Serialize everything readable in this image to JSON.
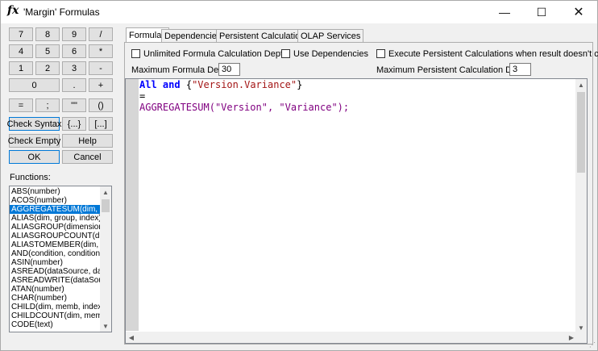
{
  "window": {
    "title": "'Margin' Formulas",
    "icon": "fx",
    "minimize": "—",
    "maximize": "☐",
    "close": "✕"
  },
  "keypad": [
    "7",
    "8",
    "9",
    "/",
    "4",
    "5",
    "6",
    "*",
    "1",
    "2",
    "3",
    "-",
    "0",
    ".",
    "+",
    "=",
    ";",
    "\"\"",
    "()"
  ],
  "buttons": {
    "check_syntax": "Check Syntax",
    "braces": "{...}",
    "brackets": "[...]",
    "check_empty": "Check Empty",
    "help": "Help",
    "ok": "OK",
    "cancel": "Cancel"
  },
  "functions": {
    "label": "Functions:",
    "items": [
      "ABS(number)",
      "ACOS(number)",
      "AGGREGATESUM(dim, memb",
      "ALIAS(dim, group, index)",
      "ALIASGROUP(dimension, ir",
      "ALIASGROUPCOUNT(dime",
      "ALIASTOMEMBER(dim, gro",
      "AND(condition, condition, ...",
      "ASIN(number)",
      "ASREAD(dataSource, data",
      "ASREADWRITE(dataSourc",
      "ATAN(number)",
      "CHAR(number)",
      "CHILD(dim, memb, index)",
      "CHILDCOUNT(dim, memb)",
      "CODE(text)"
    ],
    "selected_index": 2
  },
  "tabs": [
    "Formulas",
    "Dependencies",
    "Persistent Calculations",
    "OLAP Services"
  ],
  "options": {
    "unlimited_depth": "Unlimited Formula Calculation Depth",
    "use_dependencies": "Use Dependencies",
    "execute_persistent": "Execute Persistent Calculations when result doesn't change",
    "max_formula_depth_label": "Maximum Formula Depth:",
    "max_formula_depth_value": "30",
    "max_persistent_depth_label": "Maximum Persistent Calculation Depth:",
    "max_persistent_depth_value": "3"
  },
  "code": {
    "line1_kw1": "All",
    "line1_kw2": "and",
    "line1_open": "{",
    "line1_str": "\"Version.Variance\"",
    "line1_close": "}",
    "line2": "=",
    "line3_fn": "AGGREGATESUM",
    "line3_open": "(",
    "line3_arg1": "\"Version\"",
    "line3_sep": ", ",
    "line3_arg2": "\"Variance\"",
    "line3_close": ");"
  },
  "icons": {
    "scroll_up": "▲",
    "scroll_down": "▼",
    "scroll_left": "◀",
    "scroll_right": "▶",
    "grip": "⋰"
  }
}
